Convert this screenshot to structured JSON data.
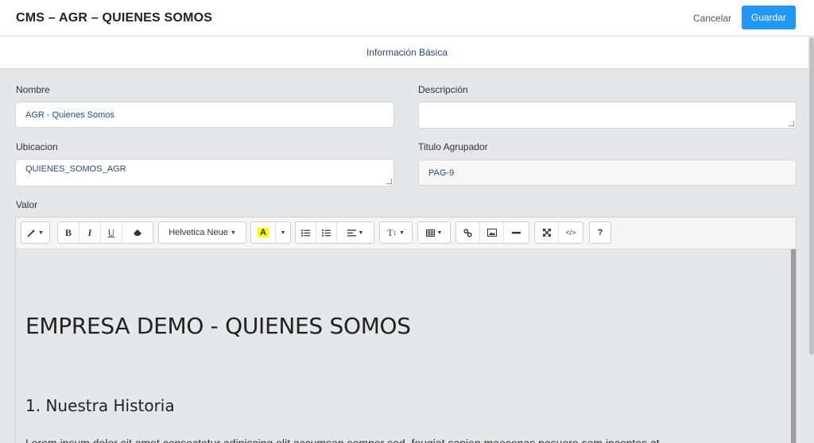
{
  "header": {
    "title": "CMS – AGR – QUIENES SOMOS",
    "cancel_label": "Cancelar",
    "save_label": "Guardar"
  },
  "tabs": [
    {
      "label": "Información Básica",
      "active": true
    }
  ],
  "form": {
    "nombre_label": "Nombre",
    "nombre_value": "AGR - Quienes Somos",
    "descripcion_label": "Descripción",
    "descripcion_value": "",
    "ubicacion_label": "Ubicacion",
    "ubicacion_value": "QUIENES_SOMOS_AGR",
    "titulo_label": "Titulo Agrupador",
    "titulo_value": "PAG-9",
    "valor_label": "Valor"
  },
  "editor": {
    "toolbar": {
      "style_label": "",
      "bold": "B",
      "italic": "I",
      "underline": "U",
      "font_name": "Helvetica Neue",
      "color_label": "A",
      "fontsize_label": "T",
      "help_label": "?"
    },
    "content": {
      "heading": "EMPRESA DEMO - QUIENES SOMOS",
      "subheading": "1. Nuestra Historia",
      "paragraph": "Lorem ipsum dolor sit amet consectetur adipiscing elit accumsan semper sed, feugiat sapien maecenas posuere sem inceptos at"
    }
  },
  "colors": {
    "accent": "#2196f3",
    "title_text": "#2c4a78",
    "background": "#e6e7e8"
  }
}
